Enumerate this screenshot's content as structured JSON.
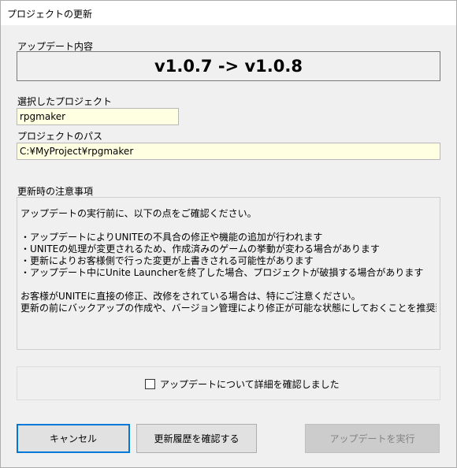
{
  "window": {
    "title": "プロジェクトの更新"
  },
  "update_content": {
    "label": "アップデート内容",
    "version_text": "v1.0.7 -> v1.0.8"
  },
  "selected_project": {
    "label": "選択したプロジェクト",
    "value": "rpgmaker"
  },
  "project_path": {
    "label": "プロジェクトのパス",
    "value": "C:¥MyProject¥rpgmaker"
  },
  "notes": {
    "label": "更新時の注意事項",
    "lines": [
      "アップデートの実行前に、以下の点をご確認ください。",
      "",
      "・アップデートによりUNITEの不具合の修正や機能の追加が行われます",
      "・UNITEの処理が変更されるため、作成済みのゲームの挙動が変わる場合があります",
      "・更新によりお客様側で行った変更が上書きされる可能性があります",
      "・アップデート中にUnite Launcherを終了した場合、プロジェクトが破損する場合があります",
      "",
      "お客様がUNITEに直接の修正、改修をされている場合は、特にご注意ください。",
      "更新の前にバックアップの作成や、バージョン管理により修正が可能な状態にしておくことを推奨致します。"
    ]
  },
  "confirm": {
    "checkbox_label": "アップデートについて詳細を確認しました",
    "checked": false
  },
  "buttons": {
    "cancel": "キャンセル",
    "history": "更新履歴を確認する",
    "execute": "アップデートを実行"
  }
}
